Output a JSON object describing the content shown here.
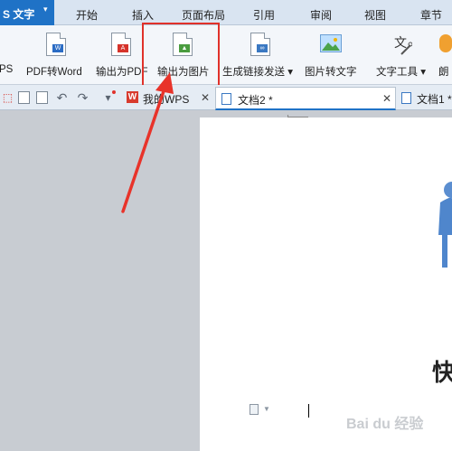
{
  "app": {
    "label": "S 文字",
    "caret": "▾"
  },
  "menu": [
    "开始",
    "插入",
    "页面布局",
    "引用",
    "审阅",
    "视图",
    "章节"
  ],
  "ribbon": {
    "left_cut": "PS",
    "buttons": [
      {
        "label": "PDF转Word"
      },
      {
        "label": "输出为PDF"
      },
      {
        "label": "输出为图片"
      },
      {
        "label": "生成链接发送 ▾"
      },
      {
        "label": "图片转文字"
      },
      {
        "label": "文字工具 ▾"
      },
      {
        "label": "朗"
      }
    ]
  },
  "tabs": {
    "tab1": "我的WPS",
    "tab2": "文档2 *",
    "tab3": "文档1 *",
    "close": "✕",
    "w_logo": "W"
  },
  "quick_access": {
    "undo": "↶",
    "redo": "↷",
    "dropdown": "▾"
  },
  "watermark": "Bai du 经验",
  "page_text": "快",
  "colors": {
    "accent": "#1f72c6",
    "highlight": "#e0312a",
    "arrow": "#e8332a"
  }
}
